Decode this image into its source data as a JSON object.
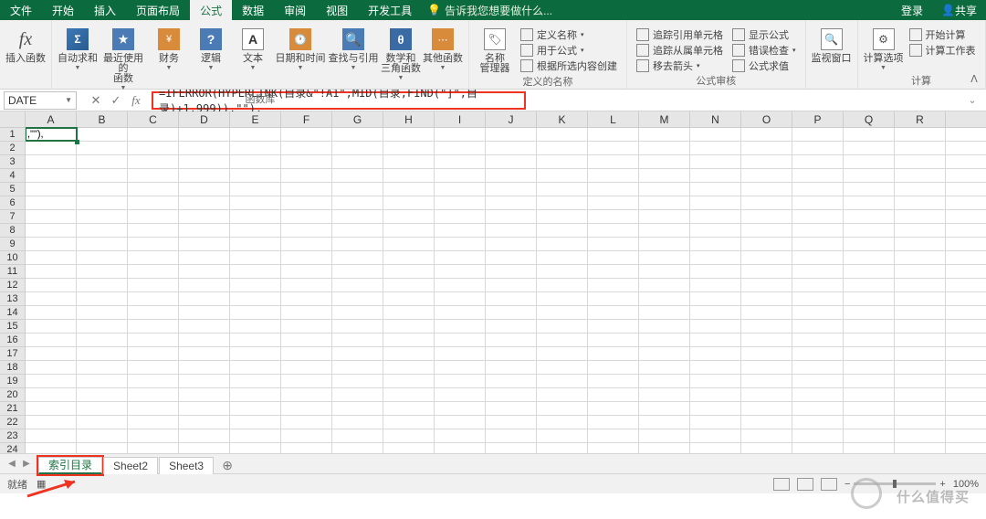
{
  "menu": {
    "file": "文件",
    "home": "开始",
    "insert": "插入",
    "layout": "页面布局",
    "formula": "公式",
    "data": "数据",
    "review": "审阅",
    "view": "视图",
    "dev": "开发工具",
    "help_placeholder": "告诉我您想要做什么...",
    "login": "登录",
    "share": "共享"
  },
  "ribbon": {
    "insert_fn": "插入函数",
    "autosum": "自动求和",
    "recent": "最近使用的\n函数",
    "financial": "财务",
    "logical": "逻辑",
    "text": "文本",
    "datetime": "日期和时间",
    "lookup": "查找与引用",
    "math": "数学和\n三角函数",
    "other": "其他函数",
    "group1": "函数库",
    "name_mgr": "名称\n管理器",
    "define_name": "定义名称",
    "use_formula": "用于公式",
    "from_sel": "根据所选内容创建",
    "group2": "定义的名称",
    "trace_prec": "追踪引用单元格",
    "trace_dep": "追踪从属单元格",
    "remove_arr": "移去箭头",
    "show_fml": "显示公式",
    "err_check": "错误检查",
    "eval": "公式求值",
    "group3": "公式审核",
    "watch": "监视窗口",
    "calc_opts": "计算选项",
    "calc_now": "开始计算",
    "calc_sheet": "计算工作表",
    "group4": "计算"
  },
  "fbar": {
    "name": "DATE",
    "formula": "=IFERROR(HYPERLINK(目录&\"!A1\",MID(目录,FIND(\"]\",目录)+1,999)),\"\"),"
  },
  "cols": [
    "A",
    "B",
    "C",
    "D",
    "E",
    "F",
    "G",
    "H",
    "I",
    "J",
    "K",
    "L",
    "M",
    "N",
    "O",
    "P",
    "Q",
    "R"
  ],
  "rows": [
    1,
    2,
    3,
    4,
    5,
    6,
    7,
    8,
    9,
    10,
    11,
    12,
    13,
    14,
    15,
    16,
    17,
    18,
    19,
    20,
    21,
    22,
    23,
    24
  ],
  "cell_a1": ",\"\"),",
  "sheets": {
    "s1": "索引目录",
    "s2": "Sheet2",
    "s3": "Sheet3"
  },
  "status": {
    "ready": "就绪",
    "zoom": "100%"
  },
  "watermark": "什么值得买"
}
